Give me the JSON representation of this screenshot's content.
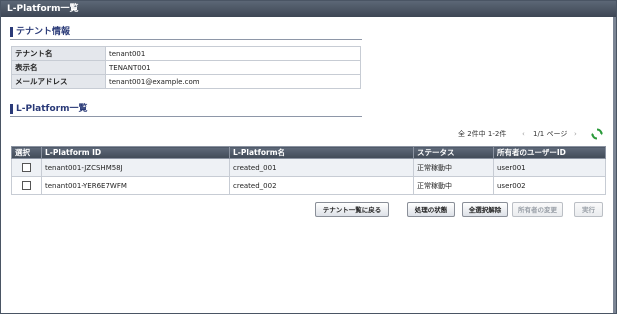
{
  "window": {
    "title": "L-Platform一覧"
  },
  "tenant_section": {
    "heading": "テナント情報",
    "rows": [
      {
        "label": "テナント名",
        "value": "tenant001"
      },
      {
        "label": "表示名",
        "value": "TENANT001"
      },
      {
        "label": "メールアドレス",
        "value": "tenant001@example.com"
      }
    ]
  },
  "lplatform_section": {
    "heading": "L-Platform一覧",
    "pager": {
      "count_text": "全 2件中 1-2件",
      "prev_symbol": "‹",
      "page_text": "1/1 ページ",
      "next_symbol": "›"
    },
    "columns": [
      "選択",
      "L-Platform ID",
      "L-Platform名",
      "ステータス",
      "所有者のユーザーID"
    ],
    "rows": [
      {
        "id": "tenant001-JZCSHM58J",
        "name": "created_001",
        "status": "正常稼動中",
        "owner": "user001"
      },
      {
        "id": "tenant001-YER6E7WFM",
        "name": "created_002",
        "status": "正常稼動中",
        "owner": "user002"
      }
    ]
  },
  "buttons": {
    "back": "テナント一覧に戻る",
    "process_status": "処理の状態",
    "deselect_all": "全選択解除",
    "change_owner": "所有者の変更",
    "execute": "実行"
  },
  "icons": {
    "refresh": "refresh-icon"
  },
  "colors": {
    "title_bar": "#3d4654",
    "section_heading": "#2a3a78",
    "table_header": "#414a57"
  }
}
